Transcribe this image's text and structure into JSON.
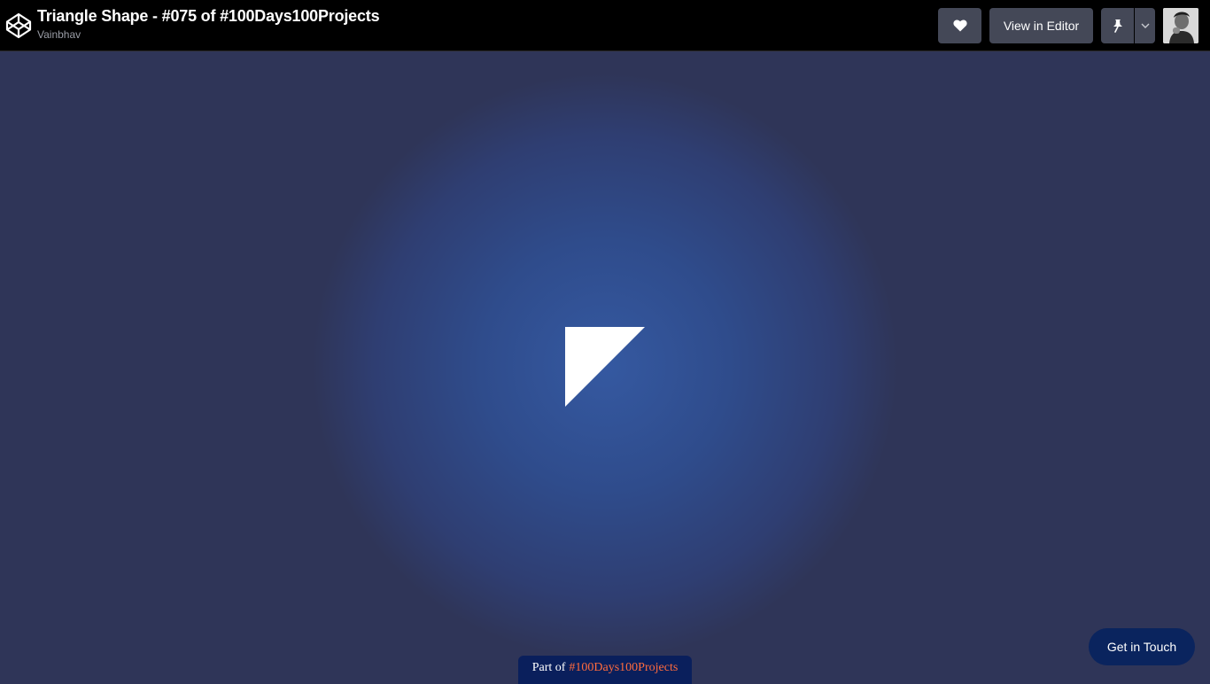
{
  "header": {
    "title": "Triangle Shape - #075 of #100Days100Projects",
    "author": "Vainbhav",
    "logo_icon": "codepen-logo-icon",
    "heart_icon": "heart-icon",
    "view_in_editor_label": "View in Editor",
    "pin_icon": "pin-icon",
    "dropdown_icon": "chevron-down-icon",
    "avatar_icon": "user-avatar"
  },
  "footer": {
    "part_of_prefix": "Part of",
    "part_of_link": "#100Days100Projects",
    "link_color": "#ff6b3d",
    "get_in_touch_label": "Get in Touch"
  },
  "colors": {
    "background": "#2f3558",
    "glow": "#3559a1",
    "shape": "#ffffff",
    "topbar": "#000000",
    "button": "#444857",
    "accent_navy": "#0a245e"
  }
}
